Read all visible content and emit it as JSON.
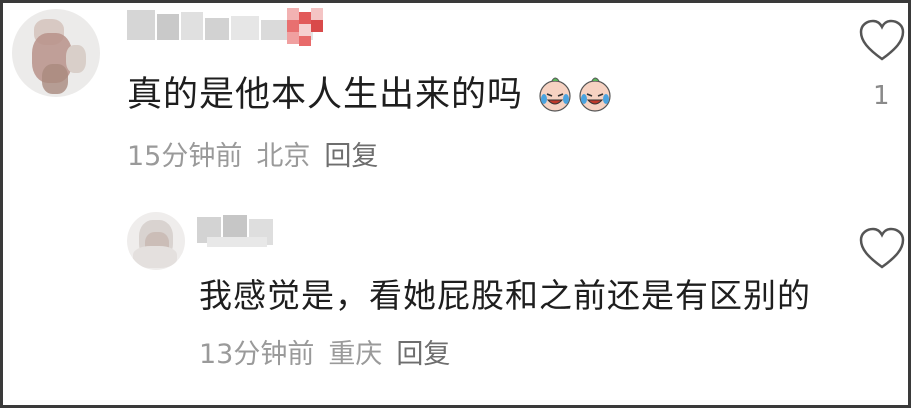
{
  "comment": {
    "text": "真的是他本人生出来的吗",
    "emojis": [
      "crying-laughing-sticker",
      "crying-laughing-sticker"
    ],
    "time": "15分钟前",
    "location": "北京",
    "reply_label": "回复",
    "like_count": "1"
  },
  "reply": {
    "text": "我感觉是，看她屁股和之前还是有区别的",
    "time": "13分钟前",
    "location": "重庆",
    "reply_label": "回复"
  },
  "colors": {
    "text": "#1e1e1e",
    "meta": "#9a9a9a",
    "border": "#3a3a3a"
  }
}
